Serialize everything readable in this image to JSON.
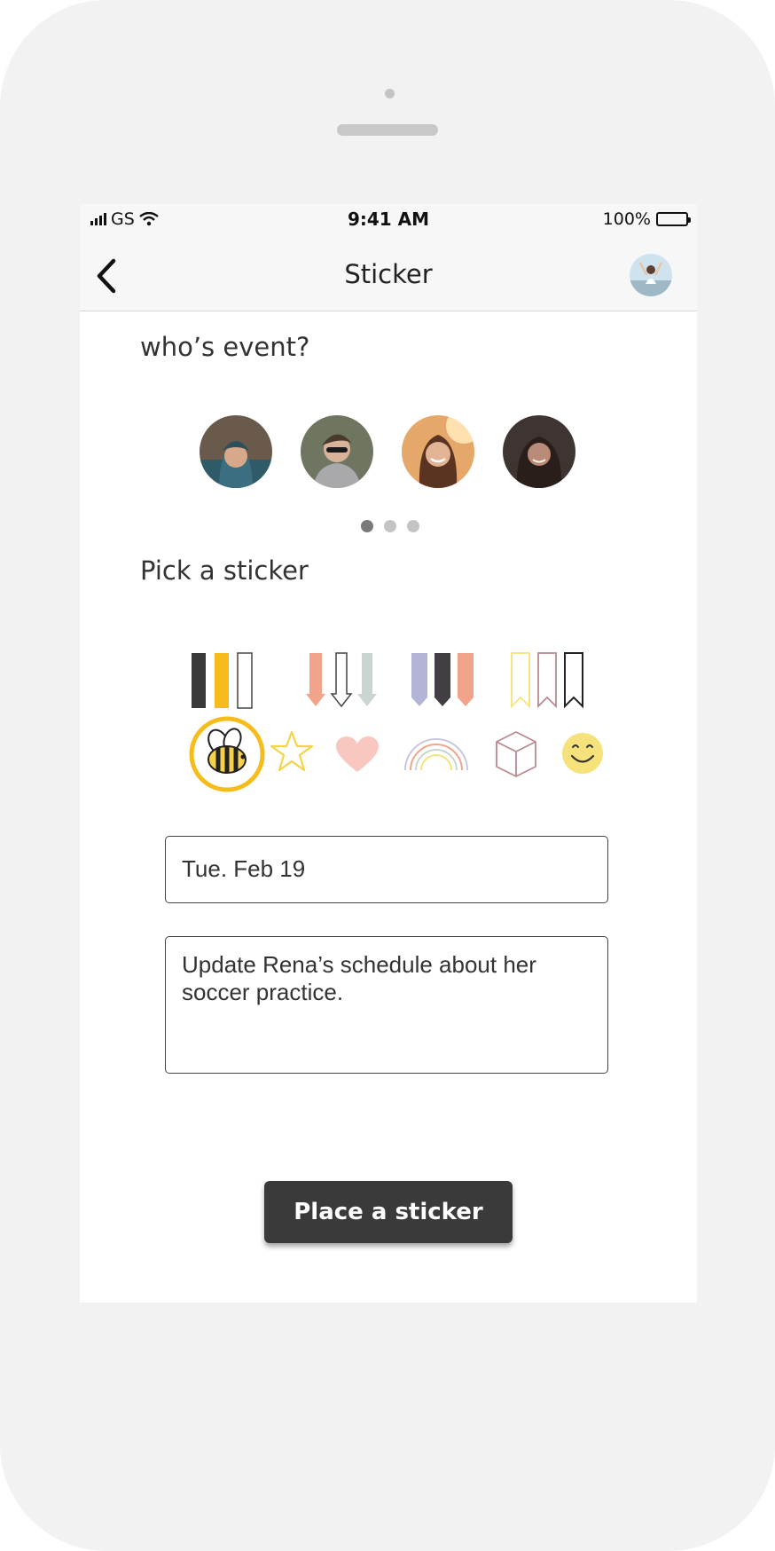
{
  "status": {
    "carrier": "GS",
    "time": "9:41 AM",
    "battery": "100%"
  },
  "nav": {
    "title": "Sticker",
    "back_icon": "chevron-left-icon",
    "profile_icon": "profile-avatar"
  },
  "whos_event": {
    "label": "who’s event?",
    "people": [
      "person-1",
      "person-2",
      "person-3",
      "person-4"
    ],
    "page_dots": 3,
    "active_dot": 1
  },
  "sticker_picker": {
    "label": "Pick a sticker",
    "row1": [
      "marker-set-dark-yellow",
      "arrow-set-salmon-white-sage",
      "pennant-set-lavender-dark-salmon",
      "bookmark-set-yellow-mauve-black"
    ],
    "row2": [
      "bee",
      "star",
      "heart",
      "rainbow",
      "cube",
      "smiley"
    ],
    "selected": "bee",
    "colors": {
      "selection_ring": "#f5bc1c",
      "dark": "#3a3a3a",
      "yellow": "#f5bc1c",
      "salmon": "#f2a48a",
      "sage": "#c9d6d0",
      "lavender": "#b4b4d6",
      "mauve": "#b88a8f",
      "heart": "#f7c7c0"
    }
  },
  "form": {
    "date_value": "Tue. Feb 19",
    "note_line1": "Update Rena’s schedule about her",
    "note_line2": "soccer practice."
  },
  "cta": {
    "label": "Place a sticker"
  }
}
